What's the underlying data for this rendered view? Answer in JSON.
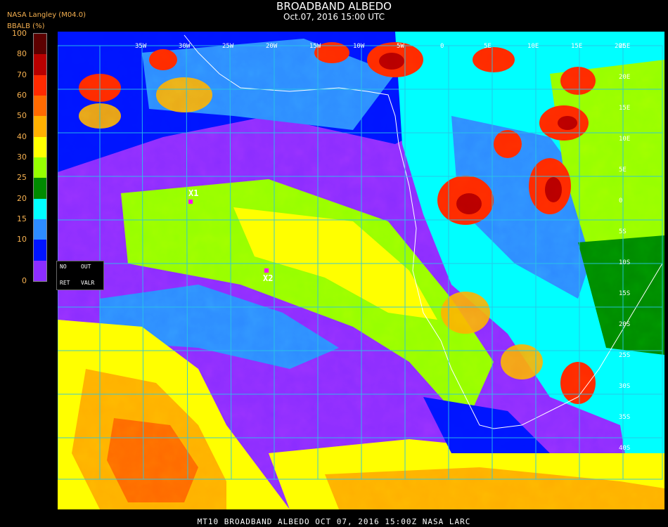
{
  "title": "BROADBAND ALBEDO",
  "subtitle": "Oct.07, 2016 15:00 UTC",
  "credit": "NASA Langley (M04.0)",
  "colorbar": {
    "title": "BBALB (%)",
    "ticks": [
      "100",
      "80",
      "70",
      "60",
      "50",
      "40",
      "30",
      "25",
      "20",
      "15",
      "10",
      "0"
    ],
    "colors": [
      "#5c0000",
      "#b80000",
      "#ff2a00",
      "#ff6a00",
      "#ffb000",
      "#ffff00",
      "#96ff00",
      "#008a00",
      "#00ffff",
      "#2d8cff",
      "#0014ff",
      "#8c2dff"
    ]
  },
  "legend_box": {
    "no": "NO",
    "out": "OUT",
    "ret": "RET",
    "valr": "VALR"
  },
  "markers": [
    {
      "label": "X1"
    },
    {
      "label": "X2"
    }
  ],
  "grid_labels": {
    "top": [
      "20E",
      "15E",
      "10E",
      "5E",
      "0",
      "5W",
      "10W",
      "15W",
      "20W",
      "25W",
      "30W",
      "35W"
    ],
    "right": [
      "25E",
      "20E",
      "15E",
      "10E",
      "5E",
      "0",
      "5S",
      "10S",
      "15S",
      "20S",
      "25S",
      "30S",
      "35S",
      "40S"
    ]
  },
  "footer": "MT10  BROADBAND ALBEDO   OCT 07, 2016 15:00Z   NASA LARC"
}
